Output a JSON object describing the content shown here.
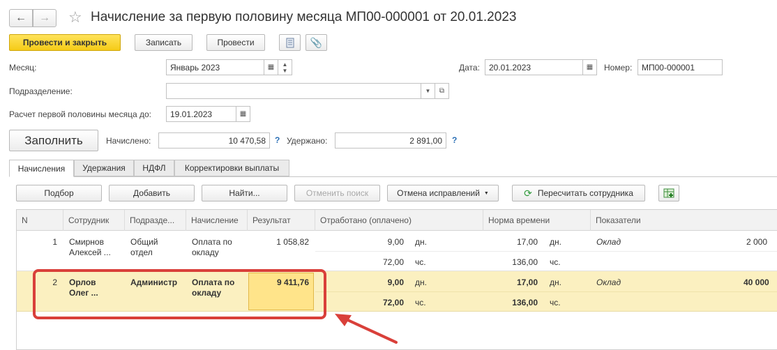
{
  "window": {
    "title": "Начисление за первую половину месяца МП00-000001 от 20.01.2023"
  },
  "toolbar": {
    "post_close": "Провести и закрыть",
    "save": "Записать",
    "post": "Провести"
  },
  "form": {
    "month_label": "Месяц:",
    "month_value": "Январь 2023",
    "date_label": "Дата:",
    "date_value": "20.01.2023",
    "number_label": "Номер:",
    "number_value": "МП00-000001",
    "dept_label": "Подразделение:",
    "dept_value": "",
    "calc_label": "Расчет первой половины месяца до:",
    "calc_value": "19.01.2023",
    "fill_button": "Заполнить",
    "accrued_label": "Начислено:",
    "accrued_value": "10 470,58",
    "withheld_label": "Удержано:",
    "withheld_value": "2 891,00",
    "help": "?"
  },
  "tabs": [
    "Начисления",
    "Удержания",
    "НДФЛ",
    "Корректировки выплаты"
  ],
  "table_toolbar": {
    "select": "Подбор",
    "add": "Добавить",
    "find": "Найти...",
    "cancel_search": "Отменить поиск",
    "cancel_fixes": "Отмена исправлений",
    "recalc": "Пересчитать сотрудника"
  },
  "table": {
    "headers": [
      "N",
      "Сотрудник",
      "Подразде...",
      "Начисление",
      "Результат",
      "Отработано (оплачено)",
      "Норма времени",
      "Показатели"
    ],
    "rows": [
      {
        "n": "1",
        "employee": [
          "Смирнов",
          "Алексей ..."
        ],
        "dept": [
          "Общий",
          "отдел"
        ],
        "accrual": [
          "Оплата по",
          "окладу"
        ],
        "result": "1 058,82",
        "worked_days": "9,00",
        "days_unit": "дн.",
        "worked_hours": "72,00",
        "hours_unit": "чс.",
        "norm_days": "17,00",
        "norm_hours": "136,00",
        "indicator": "Оклад",
        "indicator_value": "2 000"
      },
      {
        "n": "2",
        "employee": [
          "Орлов",
          "Олег ..."
        ],
        "dept": [
          "Администр",
          ""
        ],
        "accrual": [
          "Оплата по",
          "окладу"
        ],
        "result": "9 411,76",
        "worked_days": "9,00",
        "days_unit": "дн.",
        "worked_hours": "72,00",
        "hours_unit": "чс.",
        "norm_days": "17,00",
        "norm_hours": "136,00",
        "indicator": "Оклад",
        "indicator_value": "40 000"
      }
    ]
  },
  "colors": {
    "primary_button": "#f5cb17",
    "selected_row": "#fbf0c0",
    "selected_cell": "#ffe48a",
    "highlight_frame": "#d9403a",
    "help": "#2a6fb5"
  }
}
